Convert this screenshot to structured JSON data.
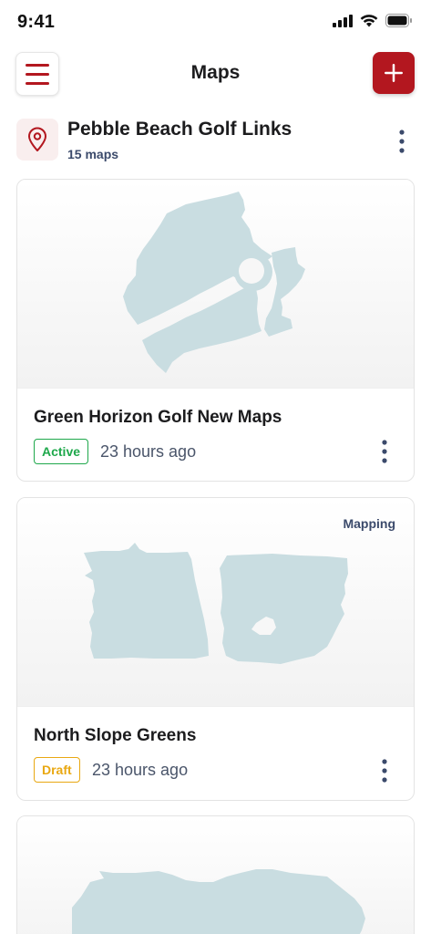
{
  "status_bar": {
    "time": "9:41"
  },
  "nav": {
    "title": "Maps",
    "icons": {
      "menu": "hamburger-menu-icon",
      "add": "plus-icon"
    }
  },
  "course": {
    "name": "Pebble Beach Golf Links",
    "maps_count": "15 maps",
    "icon": "map-pin-icon"
  },
  "colors": {
    "brand_red": "#b3171f",
    "active_green": "#1ea84b",
    "draft_amber": "#e9a812",
    "map_fill": "#c9dde1"
  },
  "maps": [
    {
      "title": "Green Horizon Golf New Maps",
      "status": "Active",
      "updated": "23 hours ago",
      "tag": ""
    },
    {
      "title": "North Slope Greens",
      "status": "Draft",
      "updated": "23 hours ago",
      "tag": "Mapping"
    },
    {
      "title": "",
      "status": "",
      "updated": "",
      "tag": ""
    }
  ]
}
